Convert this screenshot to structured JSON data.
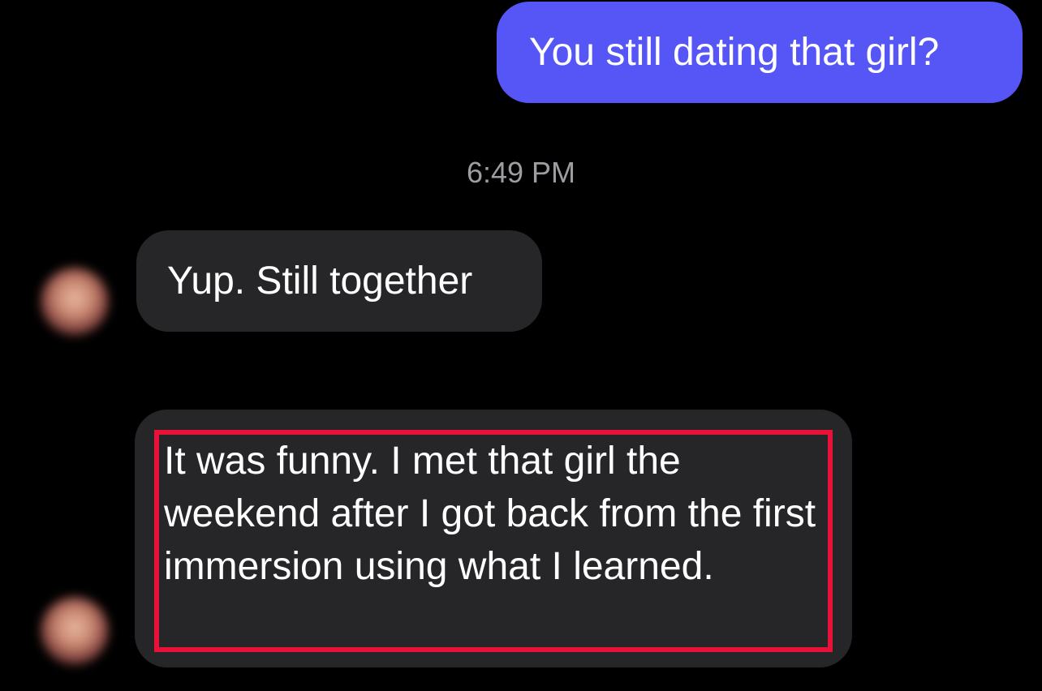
{
  "messages": {
    "outgoing_1": "You still dating that girl?",
    "timestamp": "6:49 PM",
    "incoming_1": "Yup. Still together",
    "incoming_2": "It was funny. I met that girl the weekend after I got back from the first immersion using what I learned."
  },
  "colors": {
    "background": "#000000",
    "outgoing_bubble": "#5655f5",
    "incoming_bubble": "#262628",
    "timestamp_text": "#9d9da2",
    "highlight_border": "#e8113a"
  },
  "icons": {
    "avatar": "avatar-icon"
  }
}
